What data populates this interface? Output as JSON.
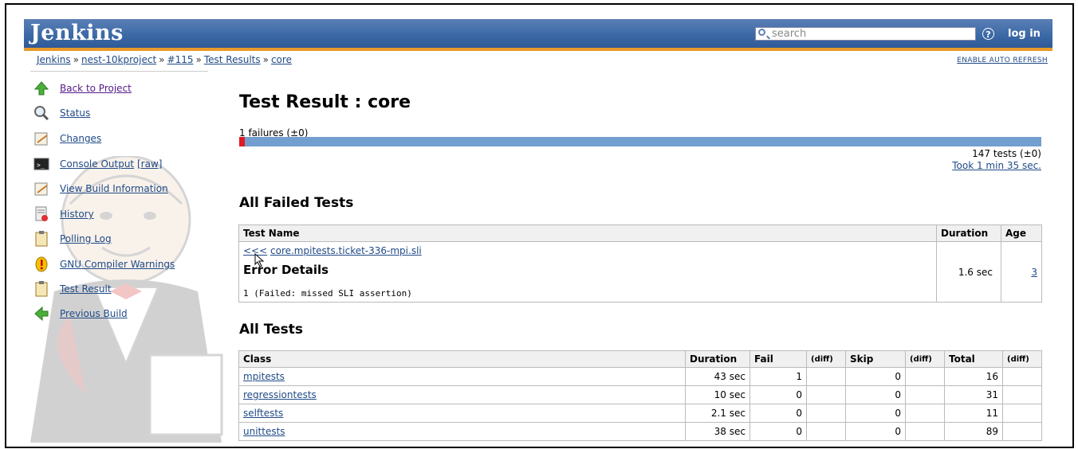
{
  "header": {
    "logo": "Jenkins",
    "search_placeholder": "search",
    "help_icon": "?",
    "login": "log in"
  },
  "breadcrumb": [
    {
      "label": "Jenkins"
    },
    {
      "label": "nest-10kproject"
    },
    {
      "label": "#115"
    },
    {
      "label": "Test Results"
    },
    {
      "label": "core"
    }
  ],
  "breadcrumb_sep": "»",
  "auto_refresh": "ENABLE AUTO REFRESH",
  "sidebar": {
    "items": [
      {
        "label": "Back to Project",
        "icon": "up-arrow-icon"
      },
      {
        "label": "Status",
        "icon": "magnifier-icon"
      },
      {
        "label": "Changes",
        "icon": "notepad-icon"
      },
      {
        "label": "Console Output",
        "suffix": "[raw]",
        "icon": "terminal-icon"
      },
      {
        "label": "View Build Information",
        "icon": "notepad-icon"
      },
      {
        "label": "History",
        "icon": "history-icon"
      },
      {
        "label": "Polling Log",
        "icon": "clipboard-icon"
      },
      {
        "label": "GNU Compiler Warnings",
        "icon": "warning-icon"
      },
      {
        "label": "Test Result",
        "icon": "clipboard-icon"
      },
      {
        "label": "Previous Build",
        "icon": "left-arrow-icon"
      }
    ]
  },
  "main": {
    "title": "Test Result : core",
    "failures": "1 failures (±0)",
    "fail_fraction": 0.0068,
    "tests_count": "147 tests (±0)",
    "took": "Took 1 min 35 sec.",
    "failed_heading": "All Failed Tests",
    "failed_table": {
      "headers": [
        "Test Name",
        "Duration",
        "Age"
      ],
      "row": {
        "expand": "<<<",
        "name": "core.mpitests.ticket-336-mpi.sli",
        "error_title": "Error Details",
        "error_msg": "1 (Failed: missed SLI assertion)",
        "duration": "1.6 sec",
        "age": "3"
      }
    },
    "all_heading": "All Tests",
    "all_table": {
      "headers": [
        "Class",
        "Duration",
        "Fail",
        "(diff)",
        "Skip",
        "(diff)",
        "Total",
        "(diff)"
      ],
      "rows": [
        {
          "class": "mpitests",
          "duration": "43 sec",
          "fail": "1",
          "fail_diff": "",
          "skip": "0",
          "skip_diff": "",
          "total": "16",
          "total_diff": ""
        },
        {
          "class": "regressiontests",
          "duration": "10 sec",
          "fail": "0",
          "fail_diff": "",
          "skip": "0",
          "skip_diff": "",
          "total": "31",
          "total_diff": ""
        },
        {
          "class": "selftests",
          "duration": "2.1 sec",
          "fail": "0",
          "fail_diff": "",
          "skip": "0",
          "skip_diff": "",
          "total": "11",
          "total_diff": ""
        },
        {
          "class": "unittests",
          "duration": "38 sec",
          "fail": "0",
          "fail_diff": "",
          "skip": "0",
          "skip_diff": "",
          "total": "89",
          "total_diff": ""
        }
      ]
    }
  },
  "colors": {
    "header": "#3c6aa7",
    "accent": "#e89a29",
    "link": "#204a87",
    "bar_pass": "#729fcf",
    "bar_fail": "#e01b24"
  }
}
